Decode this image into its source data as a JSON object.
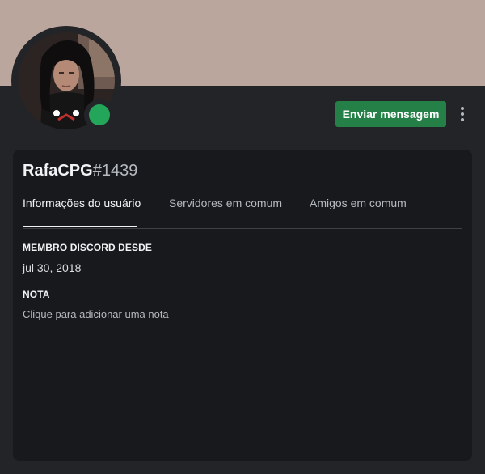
{
  "profile": {
    "username": "RafaCPG",
    "discriminator": "#1439",
    "status": "online",
    "banner_color": "#bba69e",
    "status_color": "#23a55a",
    "avatar_icon": "user-avatar"
  },
  "actions": {
    "send_message_label": "Enviar mensagem",
    "more_icon": "vertical-ellipsis-icon",
    "button_color": "#248046"
  },
  "tabs": [
    {
      "label": "Informações do usuário",
      "active": true
    },
    {
      "label": "Servidores em comum",
      "active": false
    },
    {
      "label": "Amigos em comum",
      "active": false
    }
  ],
  "member_since": {
    "title": "MEMBRO DISCORD DESDE",
    "value": "jul 30, 2018"
  },
  "note": {
    "title": "NOTA",
    "placeholder": "Clique para adicionar uma nota"
  }
}
